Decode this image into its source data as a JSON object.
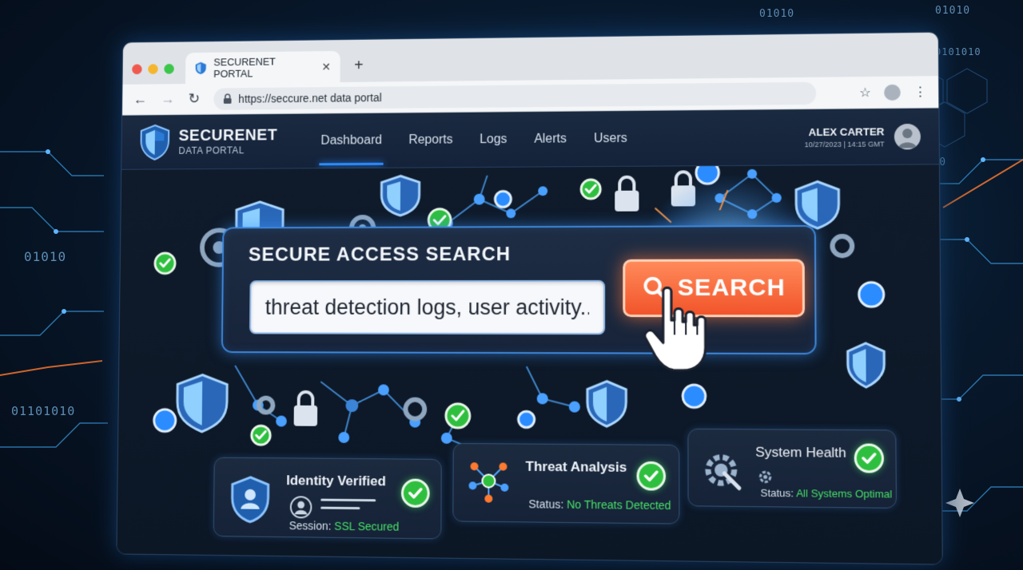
{
  "browser": {
    "tab_title": "SECURENET PORTAL",
    "tab_close": "✕",
    "new_tab": "+",
    "url": "https://seccure.net data portal"
  },
  "app": {
    "brand_title": "SECURENET",
    "brand_subtitle": "DATA PORTAL",
    "nav": [
      "Dashboard",
      "Reports",
      "Logs",
      "Alerts",
      "Users"
    ],
    "active_nav": "Dashboard",
    "user": {
      "name": "ALEX CARTER",
      "timestamp": "10/27/2023 | 14:15 GMT"
    }
  },
  "search": {
    "title": "SECURE ACCESS SEARCH",
    "value": "threat detection logs, user activity...",
    "button_label": "SEARCH"
  },
  "cards": {
    "identity": {
      "title": "Identity Verified",
      "status_prefix": "Session:",
      "status_value": "SSL Secured"
    },
    "threat": {
      "title": "Threat Analysis",
      "status_prefix": "Status:",
      "status_value": "No Threats Detected"
    },
    "health": {
      "title": "System Health",
      "status_prefix": "Status:",
      "status_value": "All Systems Optimal"
    }
  },
  "background_text": [
    "01010",
    "01010",
    "01010",
    "01010",
    "01101010",
    "0101010",
    "01010"
  ],
  "colors": {
    "accent_blue": "#2b8cff",
    "search_orange": "#f2542a",
    "success_green": "#2fbf3f",
    "status_green": "#48e06a"
  },
  "icons": [
    "shield-icon",
    "lock-icon",
    "gear-icon",
    "check-icon",
    "network-icon",
    "user-icon",
    "search-icon",
    "hand-cursor-icon",
    "star-icon"
  ]
}
